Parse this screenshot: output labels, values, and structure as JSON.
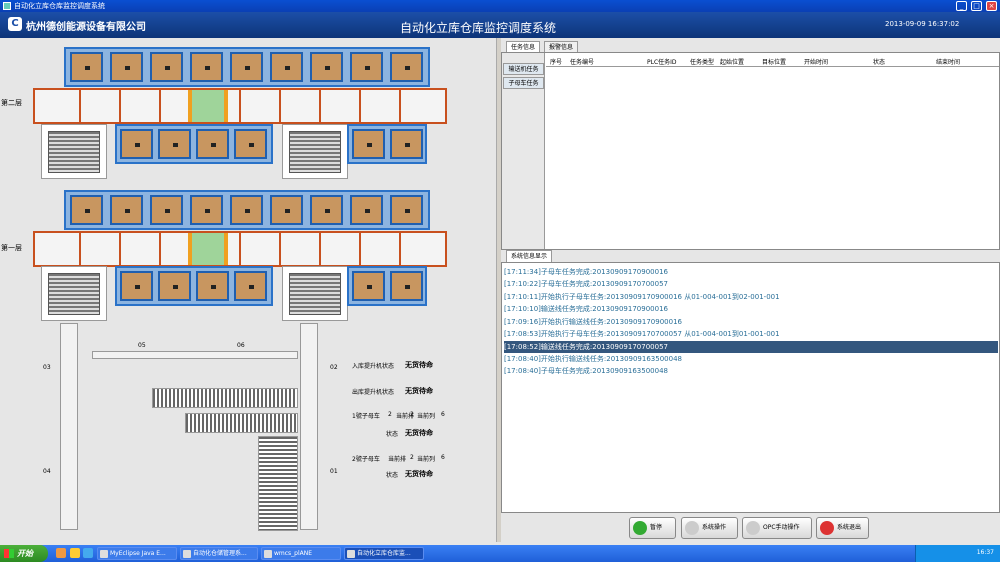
{
  "window": {
    "title": "自动化立库仓库监控调度系统"
  },
  "header": {
    "company": "杭州德创能源设备有限公司",
    "system_name": "自动化立库仓库监控调度系统",
    "datetime": "2013-09-09 16:37:02"
  },
  "layers": {
    "upper": "第二层",
    "lower": "第一层"
  },
  "conveyor_labels": {
    "l03": "03",
    "l04": "04",
    "l05": "05",
    "l06": "06",
    "l02": "02",
    "l01": "01"
  },
  "status": {
    "inbound_lift_label": "入库提升机状态",
    "inbound_lift_value": "无货待命",
    "outbound_lift_label": "出库提升机状态",
    "outbound_lift_value": "无货待命",
    "car1_label": "1號子母车",
    "car1_row_label": "当前排",
    "car1_row": "2",
    "car1_col_label": "当前列",
    "car1_col": "6",
    "car1_state_label": "状态",
    "car1_state": "无货待命",
    "car2_label": "2號子母车",
    "car2_row_label": "当前排",
    "car2_row": "2",
    "car2_col_label": "当前列",
    "car2_col": "6",
    "car2_state_label": "状态",
    "car2_state": "无货待命"
  },
  "tabs": {
    "task_info": "任务信息",
    "alarm_info": "报警信息",
    "system_info": "系统信息显示"
  },
  "side_tabs": {
    "conveyor": "输送机任务",
    "mother_car": "子母车任务"
  },
  "table_headers": [
    "序号",
    "任务编号",
    "PLC任务ID",
    "任务类型",
    "起始位置",
    "目标位置",
    "开始时间",
    "状态",
    "结束时间"
  ],
  "log": [
    {
      "text": "[17:11:34]子母车任务完成:20130909170900016",
      "selected": false
    },
    {
      "text": "[17:10:22]子母车任务完成:20130909170700057",
      "selected": false
    },
    {
      "text": "[17:10:11]开始执行子母车任务:20130909170900016 从01-004-001到02-001-001",
      "selected": false
    },
    {
      "text": "[17:10:10]输送线任务完成:20130909170900016",
      "selected": false
    },
    {
      "text": "[17:09:16]开始执行输送线任务:20130909170900016",
      "selected": false
    },
    {
      "text": "[17:08:53]开始执行子母车任务:20130909170700057 从01-004-001到01-001-001",
      "selected": false
    },
    {
      "text": "[17:08:52]输送线任务完成:20130909170700057",
      "selected": true
    },
    {
      "text": "[17:08:40]开始执行输送线任务:20130909163500048",
      "selected": false
    },
    {
      "text": "[17:08:40]子母车任务完成:20130909163500048",
      "selected": false
    }
  ],
  "buttons": {
    "pause": "暂停",
    "sys_op": "系统操作",
    "opc": "OPC手动操作",
    "exit": "系统退出"
  },
  "taskbar": {
    "start": "开始",
    "items": [
      "MyEclipse Java E...",
      "自动化仓储管理系...",
      "wmcs_plANE",
      "自动化立库仓库监..."
    ],
    "time": "16:37"
  },
  "colors": {
    "header": "#1c4fa8",
    "rack_border": "#2a72c8",
    "rail": "#c8501e",
    "box": "#c89660",
    "selected_log": "#34577e"
  }
}
